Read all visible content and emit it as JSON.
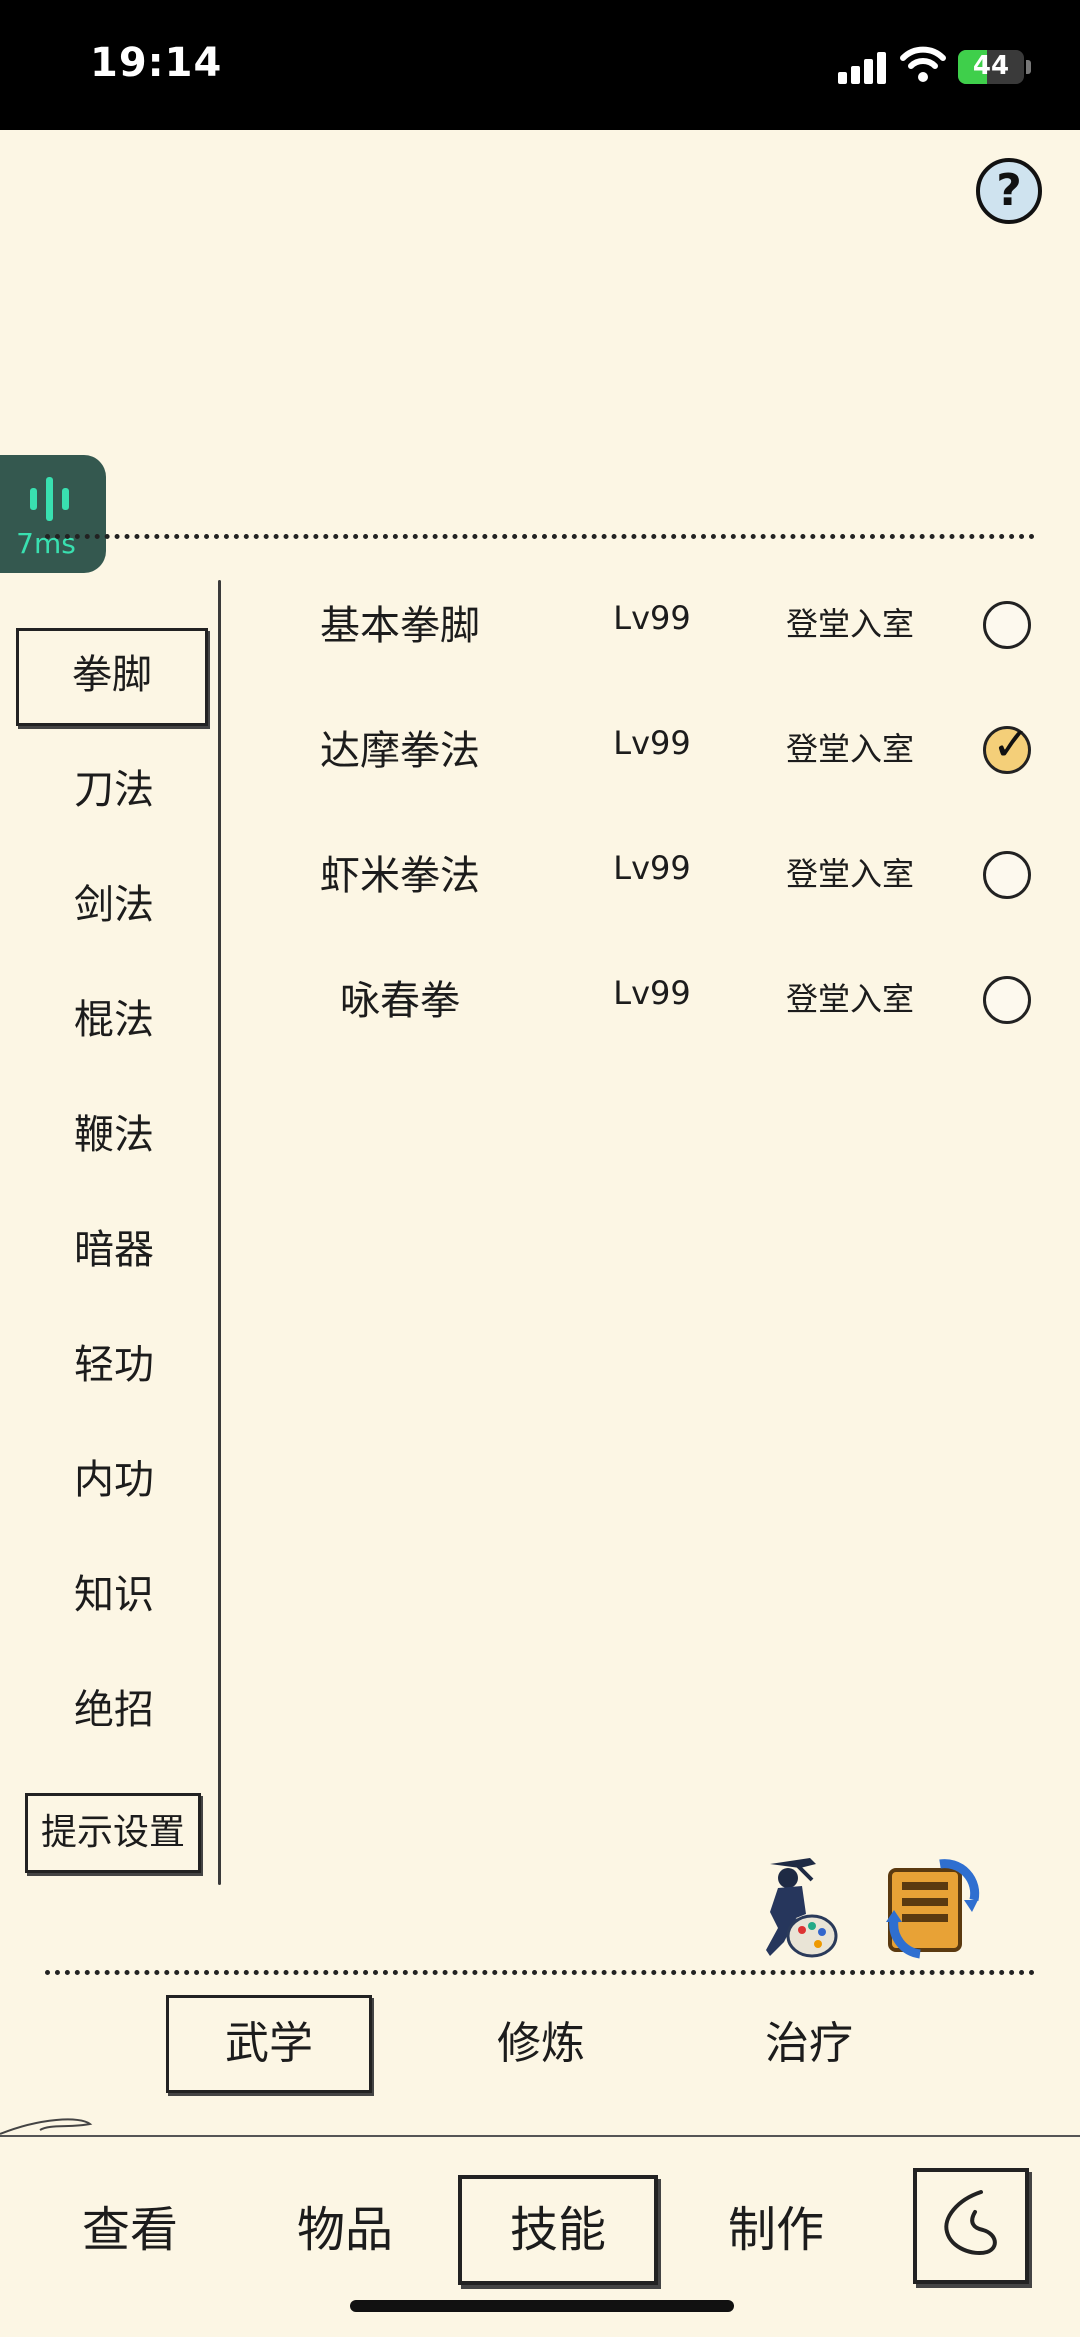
{
  "status_bar": {
    "time": "19:14",
    "battery": "44",
    "battery_level": 0.44
  },
  "ping": {
    "label": "7ms"
  },
  "help": {
    "label": "?"
  },
  "categories": [
    {
      "label": "拳脚",
      "selected": true
    },
    {
      "label": "刀法"
    },
    {
      "label": "剑法"
    },
    {
      "label": "棍法"
    },
    {
      "label": "鞭法"
    },
    {
      "label": "暗器"
    },
    {
      "label": "轻功"
    },
    {
      "label": "内功"
    },
    {
      "label": "知识"
    },
    {
      "label": "绝招"
    }
  ],
  "hint_settings": "提示设置",
  "skills": [
    {
      "name": "基本拳脚",
      "level": "Lv99",
      "rank": "登堂入室",
      "checked": false
    },
    {
      "name": "达摩拳法",
      "level": "Lv99",
      "rank": "登堂入室",
      "checked": true
    },
    {
      "name": "虾米拳法",
      "level": "Lv99",
      "rank": "登堂入室",
      "checked": false
    },
    {
      "name": "咏春拳",
      "level": "Lv99",
      "rank": "登堂入室",
      "checked": false
    }
  ],
  "sub_tabs": [
    {
      "label": "武学",
      "active": true
    },
    {
      "label": "修炼"
    },
    {
      "label": "治疗"
    }
  ],
  "bottom_nav": [
    {
      "label": "查看"
    },
    {
      "label": "物品"
    },
    {
      "label": "技能",
      "active": true
    },
    {
      "label": "制作"
    }
  ],
  "icons": {
    "help": "question-icon",
    "back": "back-icon",
    "ninja": "ninja-palette-icon",
    "scroll": "scroll-refresh-icon"
  }
}
